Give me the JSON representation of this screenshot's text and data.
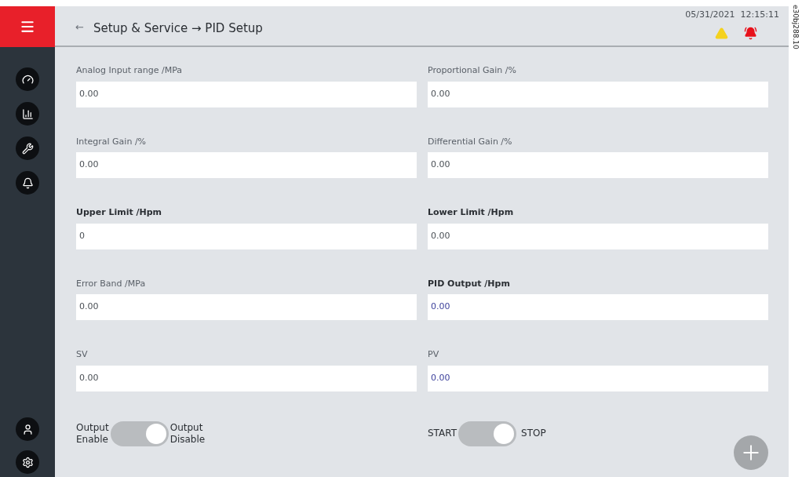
{
  "header": {
    "back_icon": "←",
    "title": "Setup & Service → PID Setup",
    "datetime": "05/31/2021  12:15:11"
  },
  "sidebar": {
    "items": [
      {
        "kind": "gauge",
        "selected": false
      },
      {
        "kind": "chart",
        "selected": false
      },
      {
        "kind": "wrench",
        "selected": false
      },
      {
        "kind": "bell",
        "selected": false
      }
    ],
    "bottom_items": [
      {
        "kind": "user"
      },
      {
        "kind": "gear"
      }
    ]
  },
  "fields": [
    {
      "label": "Analog Input range /MPa",
      "value": "0.00",
      "emphasis": false,
      "readonly": false
    },
    {
      "label": "Proportional Gain /%",
      "value": "0.00",
      "emphasis": false,
      "readonly": false
    },
    {
      "label": "Integral Gain /%",
      "value": "0.00",
      "emphasis": false,
      "readonly": false
    },
    {
      "label": "Differential Gain /%",
      "value": "0.00",
      "emphasis": false,
      "readonly": false
    },
    {
      "label": "Upper Limit /Hpm",
      "value": "0",
      "emphasis": true,
      "readonly": false
    },
    {
      "label": "Lower Limit /Hpm",
      "value": "0.00",
      "emphasis": true,
      "readonly": false
    },
    {
      "label": "Error Band /MPa",
      "value": "0.00",
      "emphasis": false,
      "readonly": false
    },
    {
      "label": "PID Output /Hpm",
      "value": "0.00",
      "emphasis": true,
      "readonly": true
    },
    {
      "label": "SV",
      "value": "0.00",
      "emphasis": false,
      "readonly": false
    },
    {
      "label": "PV",
      "value": "0.00",
      "emphasis": false,
      "readonly": true
    }
  ],
  "switches": [
    {
      "left_label": "Output\nEnable",
      "right_label": "Output\nDisable",
      "on": true
    },
    {
      "left_label": "START",
      "right_label": "STOP",
      "on": true
    }
  ],
  "figure_code": "e30bj288.10"
}
